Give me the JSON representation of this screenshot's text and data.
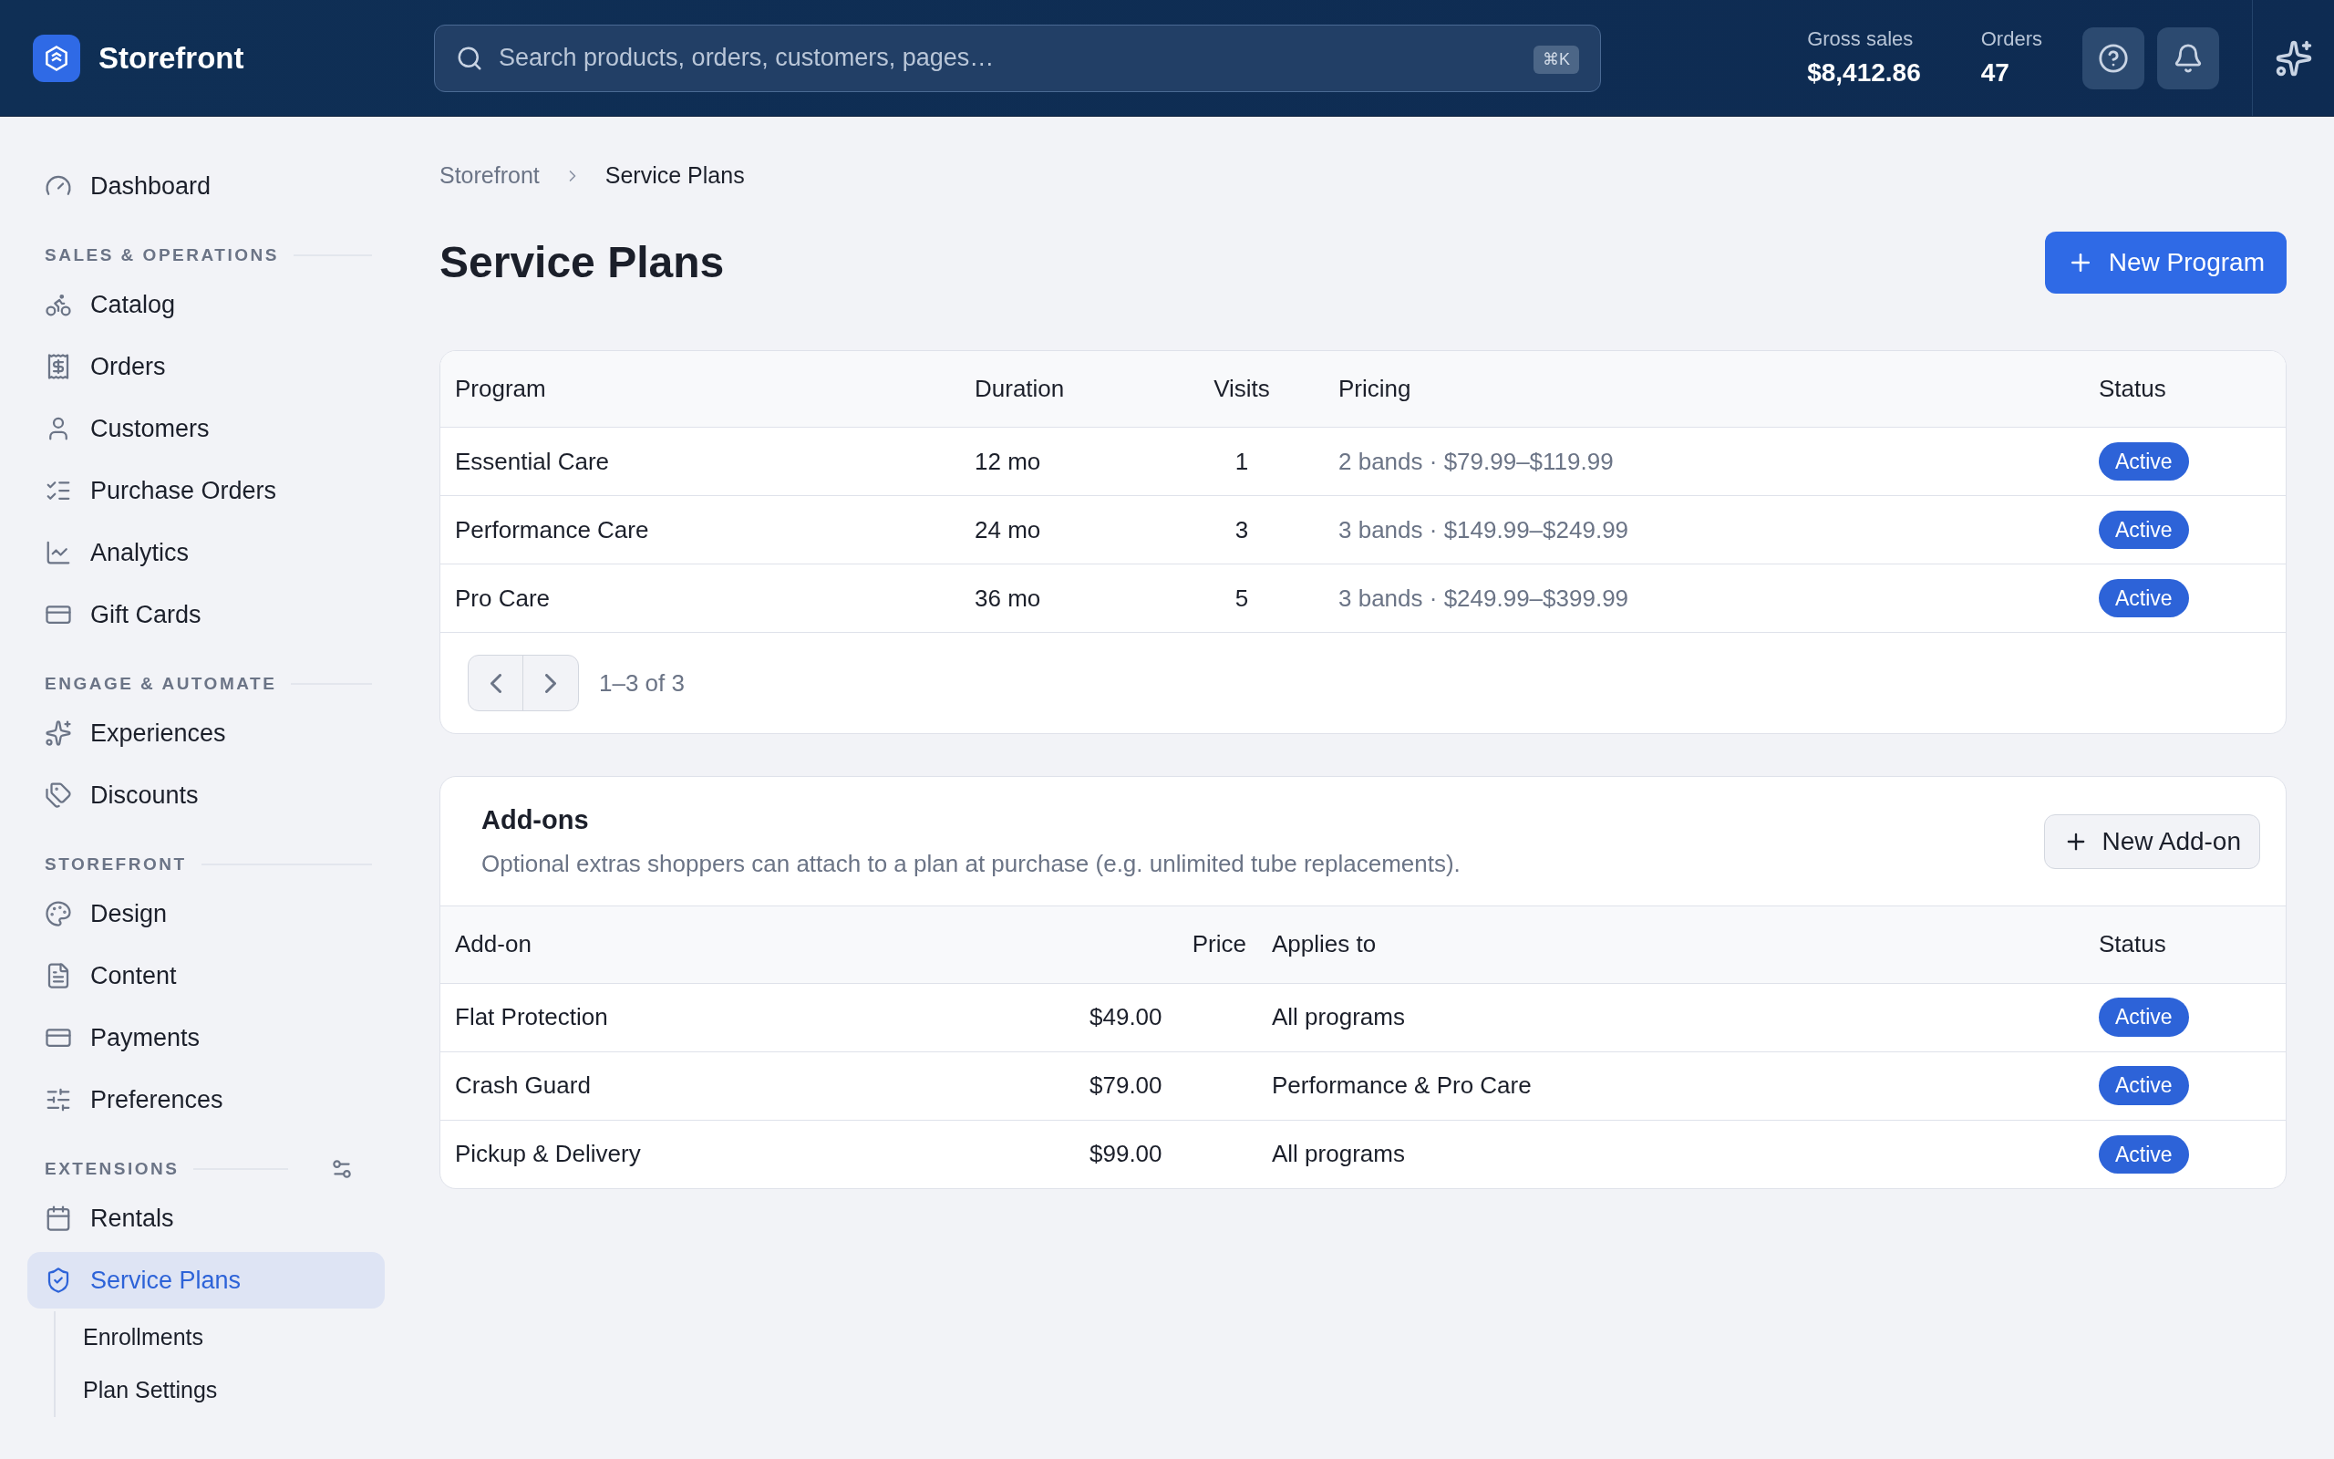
{
  "header": {
    "brand": "Storefront",
    "search": {
      "placeholder": "Search products, orders, customers, pages…",
      "shortcut": "⌘K"
    },
    "stats": [
      {
        "label": "Gross sales",
        "value": "$8,412.86"
      },
      {
        "label": "Orders",
        "value": "47"
      }
    ]
  },
  "sidebar": {
    "sections": [
      {
        "items": [
          {
            "label": "Dashboard",
            "selected": false
          }
        ]
      },
      {
        "title": "SALES & OPERATIONS",
        "items": [
          {
            "label": "Catalog",
            "selected": false
          },
          {
            "label": "Orders",
            "selected": false
          },
          {
            "label": "Customers",
            "selected": false
          },
          {
            "label": "Purchase Orders",
            "selected": false
          },
          {
            "label": "Analytics",
            "selected": false
          },
          {
            "label": "Gift Cards",
            "selected": false
          }
        ]
      },
      {
        "title": "ENGAGE & AUTOMATE",
        "items": [
          {
            "label": "Experiences",
            "selected": false
          },
          {
            "label": "Discounts",
            "selected": false
          }
        ]
      },
      {
        "title": "STOREFRONT",
        "items": [
          {
            "label": "Design",
            "selected": false
          },
          {
            "label": "Content",
            "selected": false
          },
          {
            "label": "Payments",
            "selected": false
          },
          {
            "label": "Preferences",
            "selected": false
          }
        ]
      },
      {
        "title": "EXTENSIONS",
        "items": [
          {
            "label": "Rentals",
            "selected": false
          },
          {
            "label": "Service Plans",
            "selected": true,
            "children": [
              {
                "label": "Enrollments",
                "selected": false
              },
              {
                "label": "Plan Settings",
                "selected": false
              }
            ]
          }
        ]
      }
    ]
  },
  "breadcrumb": [
    "Storefront",
    "Service Plans"
  ],
  "page_title": "Service Plans",
  "new_button": "New Program",
  "programs": {
    "columns": [
      "Program",
      "Duration",
      "Visits",
      "Pricing",
      "Status"
    ],
    "rows": [
      {
        "program": "Essential Care",
        "duration": "12 mo",
        "visits": "1",
        "pricing": "2 bands · $79.99–$119.99",
        "status": "Active"
      },
      {
        "program": "Performance Care",
        "duration": "24 mo",
        "visits": "3",
        "pricing": "3 bands · $149.99–$249.99",
        "status": "Active"
      },
      {
        "program": "Pro Care",
        "duration": "36 mo",
        "visits": "5",
        "pricing": "3 bands · $249.99–$399.99",
        "status": "Active"
      }
    ],
    "pagination": "1–3 of 3"
  },
  "addons": {
    "title": "Add-ons",
    "description": "Optional extras shoppers can attach to a plan at purchase (e.g. unlimited tube replacements).",
    "button": "New Add-on",
    "columns": [
      "Add-on",
      "Price",
      "Applies to",
      "Status"
    ],
    "rows": [
      {
        "addon": "Flat Protection",
        "price": "$49.00",
        "applies_to": "All programs",
        "status": "Active"
      },
      {
        "addon": "Crash Guard",
        "price": "$79.00",
        "applies_to": "Performance & Pro Care",
        "status": "Active"
      },
      {
        "addon": "Pickup & Delivery",
        "price": "$99.00",
        "applies_to": "All programs",
        "status": "Active"
      }
    ]
  }
}
